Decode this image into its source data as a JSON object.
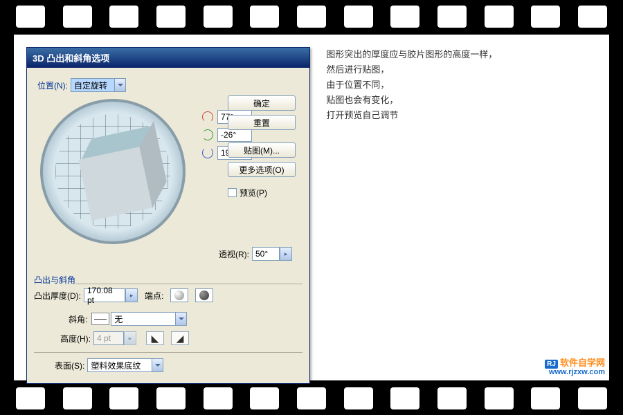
{
  "dialog": {
    "title": "3D 凸出和斜角选项",
    "position_label": "位置(N):",
    "position_value": "自定旋转",
    "rotation": {
      "x": "77°",
      "y": "-26°",
      "z": "19°"
    },
    "perspective_label": "透视(R):",
    "perspective_value": "50°",
    "section_extrude": "凸出与斜角",
    "depth_label": "凸出厚度(D):",
    "depth_value": "170.08 pt",
    "cap_label": "端点:",
    "bevel_label": "斜角:",
    "bevel_value": "无",
    "height_label": "高度(H):",
    "height_value": "4 pt",
    "surface_label": "表面(S):",
    "surface_value": "塑料效果底纹"
  },
  "buttons": {
    "ok": "确定",
    "reset": "重置",
    "map_art": "贴图(M)...",
    "more": "更多选项(O)",
    "preview": "预览(P)"
  },
  "notes": {
    "line1": "图形突出的厚度应与胶片图形的高度一样，",
    "line2": "然后进行贴图，",
    "line3": "由于位置不同，",
    "line4": "贴图也会有变化，",
    "line5": "打开预览自己调节"
  },
  "watermark": {
    "brand": "软件自学网",
    "url": "www.rjzxw.com"
  }
}
